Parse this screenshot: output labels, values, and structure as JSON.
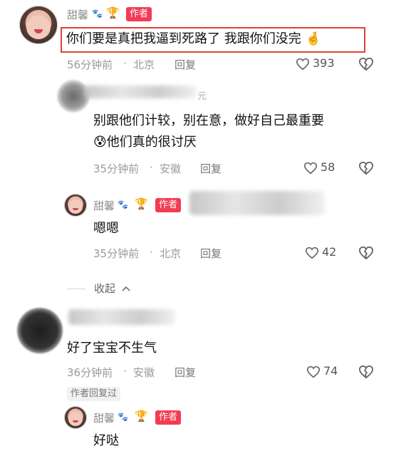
{
  "colors": {
    "accent_red": "#f23c54",
    "highlight_border": "#e3403a",
    "meta_gray": "#9a9a9a"
  },
  "author_badge": "作者",
  "reply_label": "回复",
  "comment1": {
    "username": "甜馨",
    "text": "你们要是真把我逼到死路了 我跟你们没完",
    "emoji": "🤞",
    "time": "56分钟前",
    "location": "北京",
    "likes": "393"
  },
  "comment2": {
    "username_suffix": "元",
    "text_line1": "别跟他们计较，别在意，做好自己最重要",
    "emoji": "😰",
    "text_line2": "他们真的很讨厌",
    "time": "35分钟前",
    "location": "安徽",
    "likes": "58"
  },
  "reply1": {
    "username": "甜馨",
    "text": "嗯嗯",
    "time": "35分钟前",
    "location": "北京",
    "likes": "42"
  },
  "collapse_label": "收起",
  "comment3": {
    "text": "好了宝宝不生气",
    "time": "36分钟前",
    "location": "安徽",
    "likes": "74",
    "author_replied": "作者回复过"
  },
  "reply2": {
    "username": "甜馨",
    "text": "好哒"
  }
}
